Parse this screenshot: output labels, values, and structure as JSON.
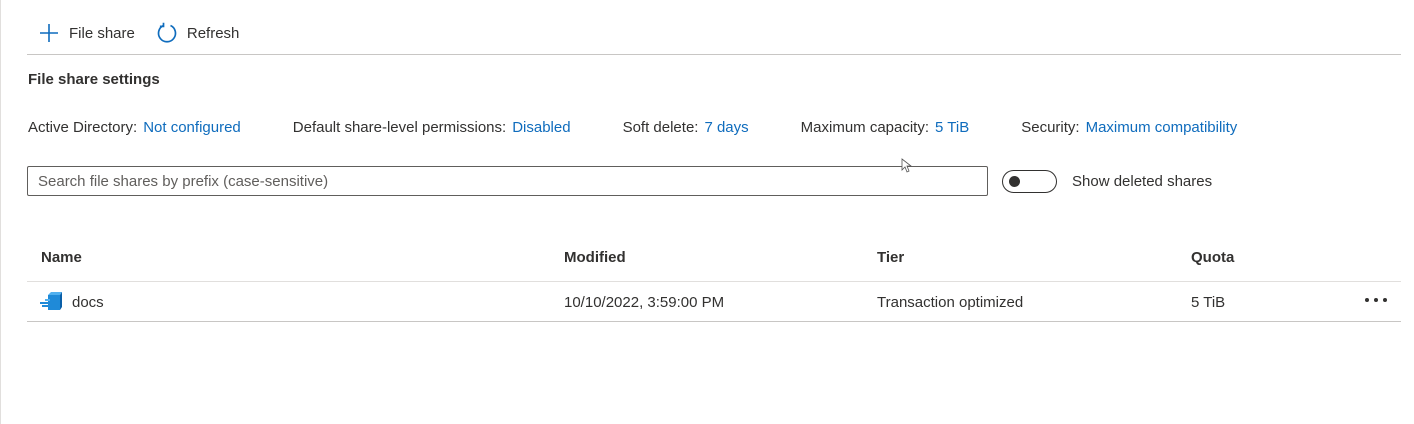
{
  "toolbar": {
    "add_label": "File share",
    "refresh_label": "Refresh"
  },
  "settings": {
    "title": "File share settings",
    "items": [
      {
        "key": "Active Directory:",
        "value": "Not configured"
      },
      {
        "key": "Default share-level permissions:",
        "value": "Disabled"
      },
      {
        "key": "Soft delete:",
        "value": "7 days"
      },
      {
        "key": "Maximum capacity:",
        "value": "5 TiB"
      },
      {
        "key": "Security:",
        "value": "Maximum compatibility"
      }
    ]
  },
  "search": {
    "placeholder": "Search file shares by prefix (case-sensitive)",
    "value": ""
  },
  "deleted_toggle": {
    "label": "Show deleted shares",
    "on": false
  },
  "table": {
    "columns": [
      "Name",
      "Modified",
      "Tier",
      "Quota"
    ],
    "rows": [
      {
        "name": "docs",
        "modified": "10/10/2022, 3:59:00 PM",
        "tier": "Transaction optimized",
        "quota": "5 TiB"
      }
    ]
  },
  "colors": {
    "link": "#0f6cbd",
    "text": "#323130",
    "icon_blue": "#1f8ad8"
  },
  "icons": {
    "add": "plus-icon",
    "refresh": "refresh-icon",
    "share": "file-share-icon",
    "more": "more-icon"
  }
}
